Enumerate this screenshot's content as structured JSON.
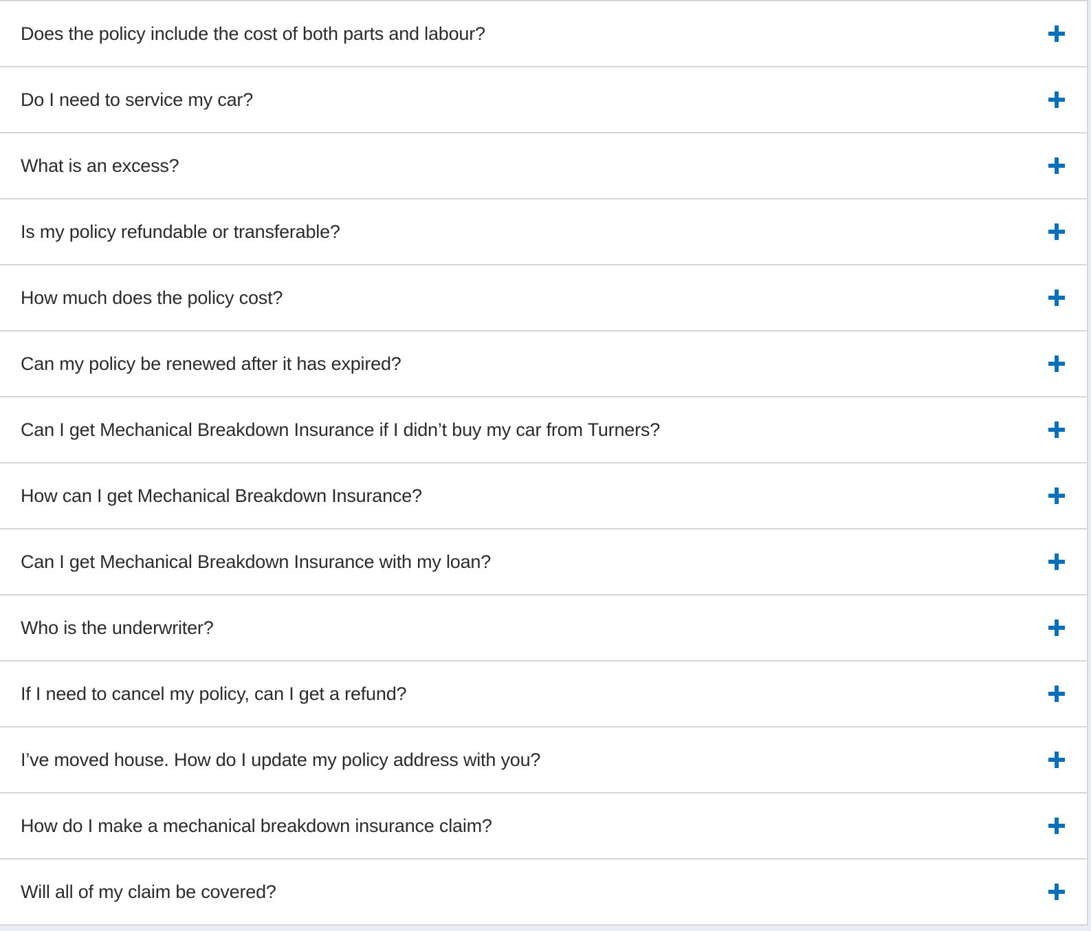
{
  "faq": {
    "items": [
      {
        "question": "Does the policy include the cost of both parts and labour?",
        "icon": "plus-icon"
      },
      {
        "question": "Do I need to service my car?",
        "icon": "plus-icon"
      },
      {
        "question": "What is an excess?",
        "icon": "plus-icon"
      },
      {
        "question": "Is my policy refundable or transferable?",
        "icon": "plus-icon"
      },
      {
        "question": "How much does the policy cost?",
        "icon": "plus-icon"
      },
      {
        "question": "Can my policy be renewed after it has expired?",
        "icon": "plus-icon"
      },
      {
        "question": "Can I get Mechanical Breakdown Insurance if I didn’t buy my car from Turners?",
        "icon": "plus-icon"
      },
      {
        "question": "How can I get Mechanical Breakdown Insurance?",
        "icon": "plus-icon"
      },
      {
        "question": "Can I get Mechanical Breakdown Insurance with my loan?",
        "icon": "plus-icon"
      },
      {
        "question": "Who is the underwriter?",
        "icon": "plus-icon"
      },
      {
        "question": "If I need to cancel my policy, can I get a refund?",
        "icon": "plus-icon"
      },
      {
        "question": "I’ve moved house. How do I update my policy address with you?",
        "icon": "plus-icon"
      },
      {
        "question": "How do I make a mechanical breakdown insurance claim?",
        "icon": "plus-icon"
      },
      {
        "question": "Will all of my claim be covered?",
        "icon": "plus-icon"
      }
    ]
  },
  "colors": {
    "accent": "#0c6fba",
    "text": "#2b2b2b",
    "border": "#d6d7da",
    "background": "#ffffff"
  }
}
